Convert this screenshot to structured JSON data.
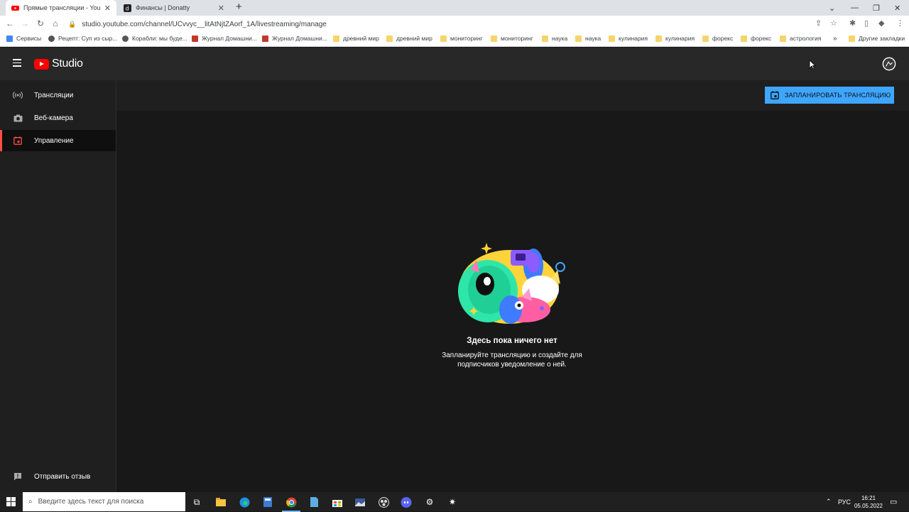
{
  "browser": {
    "tabs": [
      {
        "title": "Прямые трансляции - YouTube Studio",
        "active": true
      },
      {
        "title": "Финансы | Donatty",
        "active": false
      }
    ],
    "url": "studio.youtube.com/channel/UCvvyc__litAtNjtZAorf_1A/livestreaming/manage",
    "bookmarks": [
      {
        "label": "Сервисы",
        "icon": "apps-icon"
      },
      {
        "label": "Рецепт: Суп из сыр...",
        "icon": "site-icon"
      },
      {
        "label": "Корабли: мы буде...",
        "icon": "site-icon"
      },
      {
        "label": "Журнал Домашни...",
        "icon": "site-icon"
      },
      {
        "label": "Журнал Домашни...",
        "icon": "site-icon"
      },
      {
        "label": "древний мир",
        "icon": "folder-icon"
      },
      {
        "label": "древний мир",
        "icon": "folder-icon"
      },
      {
        "label": "мониторинг",
        "icon": "folder-icon"
      },
      {
        "label": "мониторинг",
        "icon": "folder-icon"
      },
      {
        "label": "наука",
        "icon": "folder-icon"
      },
      {
        "label": "наука",
        "icon": "folder-icon"
      },
      {
        "label": "кулинария",
        "icon": "folder-icon"
      },
      {
        "label": "кулинария",
        "icon": "folder-icon"
      },
      {
        "label": "форекс",
        "icon": "folder-icon"
      },
      {
        "label": "форекс",
        "icon": "folder-icon"
      },
      {
        "label": "астрология",
        "icon": "folder-icon"
      }
    ],
    "bookmarks_more": "»",
    "other_bookmarks": "Другие закладки"
  },
  "studio": {
    "logo_text": "Studio",
    "nav": [
      {
        "label": "Трансляции",
        "icon": "broadcast-icon",
        "active": false
      },
      {
        "label": "Веб-камера",
        "icon": "camera-icon",
        "active": false
      },
      {
        "label": "Управление",
        "icon": "calendar-icon",
        "active": true
      }
    ],
    "feedback_label": "Отправить отзыв",
    "schedule_button": "ЗАПЛАНИРОВАТЬ ТРАНСЛЯЦИЮ",
    "empty_title": "Здесь пока ничего нет",
    "empty_description": "Запланируйте трансляцию и создайте для подписчиков уведомление о ней.",
    "colors": {
      "accent": "#3ea6ff",
      "active_indicator": "#ff4e45",
      "brand": "#ff0000",
      "background": "#181818"
    }
  },
  "taskbar": {
    "search_placeholder": "Введите здесь текст для поиска",
    "language": "РУС",
    "time": "16:21",
    "date": "05.05.2022"
  }
}
